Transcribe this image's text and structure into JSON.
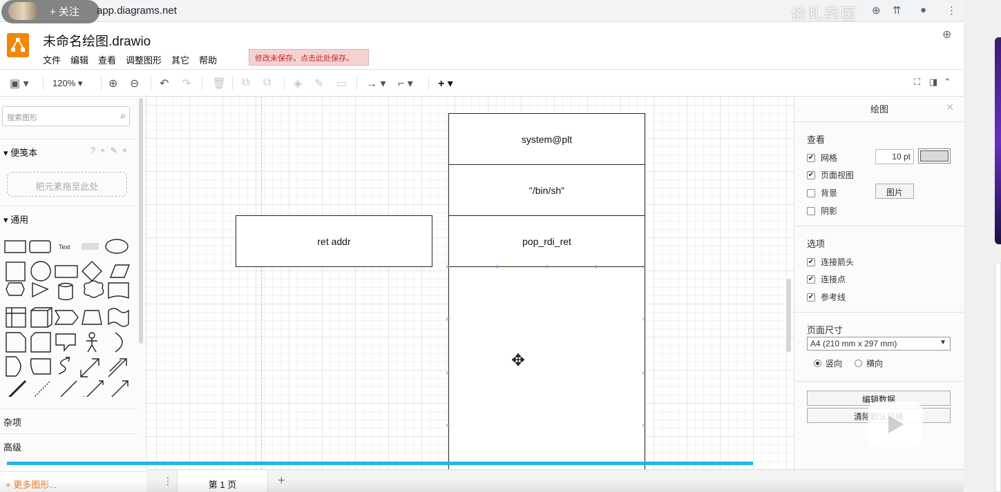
{
  "browser": {
    "url": "app.diagrams.net",
    "overlay_follow": "+ 关注",
    "watermark": "依扎药医"
  },
  "app": {
    "doc_title": "未命名绘图.drawio",
    "menu": [
      "文件",
      "编辑",
      "查看",
      "调整图形",
      "其它",
      "帮助"
    ],
    "unsaved_notice": "修改未保存。点击此处保存。"
  },
  "toolbar": {
    "zoom": "120%"
  },
  "left_panel": {
    "search_placeholder": "搜索图形",
    "scratchpad_label": "便笺本",
    "scratchpad_tools": "? + ✎ ×",
    "drop_hint": "把元素拖至此处",
    "general_label": "通用",
    "misc_label": "杂项",
    "advanced_label": "高级",
    "more_shapes": "+ 更多图形..."
  },
  "canvas": {
    "stack": [
      "system@plt",
      "\"/bin/sh\"",
      "pop_rdi_ret",
      ""
    ],
    "side_box": "ret addr"
  },
  "right_panel": {
    "title": "绘图",
    "view_header": "查看",
    "grid_label": "网格",
    "grid_checked": true,
    "grid_size": "10 pt",
    "page_view_label": "页面视图",
    "page_view_checked": true,
    "background_label": "背景",
    "background_checked": false,
    "image_button": "图片",
    "shadow_label": "阴影",
    "shadow_checked": false,
    "options_header": "选项",
    "connection_arrows_label": "连接箭头",
    "connection_points_label": "连接点",
    "guides_label": "参考线",
    "page_size_header": "页面尺寸",
    "page_size_value": "A4 (210 mm x 297 mm)",
    "portrait_label": "竖向",
    "landscape_label": "横向",
    "edit_data_button": "编辑数据",
    "clear_style_button": "清除默认风格"
  },
  "bottom": {
    "page_tab": "第 1 页"
  },
  "colors": {
    "accent_orange": "#f08705",
    "progress_blue": "#1fb5e6",
    "unsaved_bg": "#f5d2d2"
  }
}
